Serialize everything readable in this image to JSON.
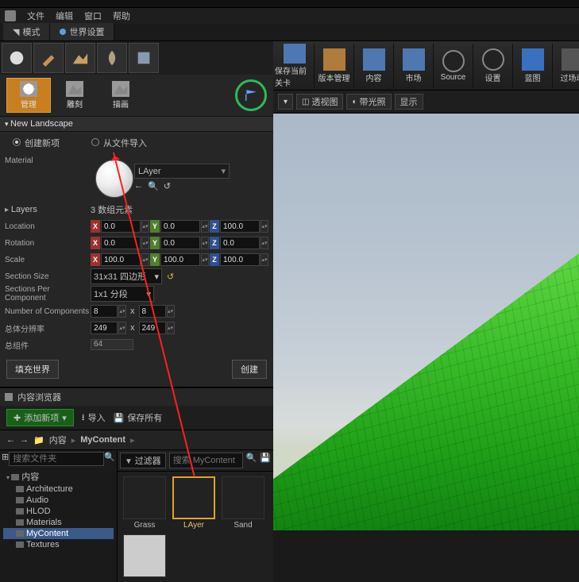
{
  "menubar": {
    "file": "文件",
    "edit": "编辑",
    "window": "窗口",
    "help": "帮助"
  },
  "tabs": {
    "mode": "模式",
    "world": "世界设置"
  },
  "sub_tools": {
    "manage": "管理",
    "sculpt": "雕刻",
    "paint": "描画"
  },
  "section": {
    "title": "New Landscape"
  },
  "radios": {
    "new": "创建新项",
    "import": "从文件导入"
  },
  "props": {
    "material_label": "Material",
    "material_name": "LAyer",
    "layers_label": "Layers",
    "layers_count": "3 数组元素",
    "location": "Location",
    "rotation": "Rotation",
    "scale": "Scale",
    "section_size": "Section Size",
    "section_size_val": "31x31 四边形",
    "spc": "Sections Per Component",
    "spc_val": "1x1 分段",
    "noc": "Number of Components",
    "resolution": "总体分辨率",
    "total": "总组件",
    "total_val": "64",
    "loc": {
      "x": "0.0",
      "y": "0.0",
      "z": "100.0"
    },
    "rot": {
      "x": "0.0",
      "y": "0.0",
      "z": "0.0"
    },
    "scl": {
      "x": "100.0",
      "y": "100.0",
      "z": "100.0"
    },
    "comp": {
      "x": "8",
      "y": "8"
    },
    "res": {
      "x": "249",
      "y": "249"
    }
  },
  "buttons": {
    "fill": "填充世界",
    "create": "创建"
  },
  "cb": {
    "title": "内容浏览器",
    "add": "添加新项",
    "import": "导入",
    "saveall": "保存所有",
    "path_root": "内容",
    "path_leaf": "MyContent",
    "search_placeholder": "搜索文件夹",
    "filter": "过滤器",
    "search2_placeholder": "搜索 MyContent",
    "root": "内容",
    "folders": [
      "Architecture",
      "Audio",
      "HLOD",
      "Materials",
      "MyContent",
      "Textures"
    ],
    "selected_folder": "MyContent",
    "assets": [
      {
        "name": "Grass",
        "kind": "grass"
      },
      {
        "name": "LAyer",
        "kind": "sphere",
        "selected": true
      },
      {
        "name": "Sand",
        "kind": "sand"
      }
    ]
  },
  "rt": {
    "buttons": [
      "保存当前关卡",
      "版本管理",
      "内容",
      "市场",
      "Source",
      "设置",
      "蓝图",
      "过场动"
    ],
    "chips": {
      "perspective": "透视图",
      "lit": "带光照",
      "show": "显示"
    }
  },
  "axis": {
    "x": "X",
    "y": "Y",
    "z": "Z",
    "times": "x"
  }
}
